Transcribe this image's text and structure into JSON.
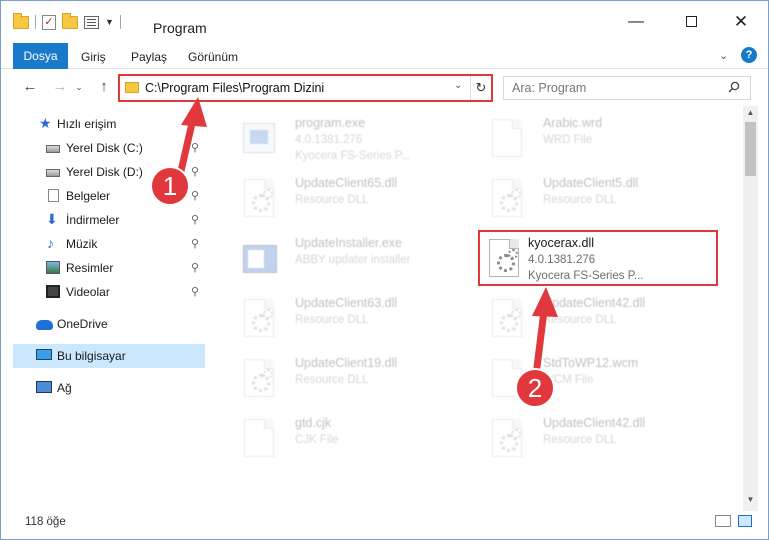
{
  "window": {
    "title": "Program",
    "minimize_glyph": "—",
    "close_glyph": "✕"
  },
  "ribbon": {
    "tabs": [
      "Dosya",
      "Giriş",
      "Paylaş",
      "Görünüm"
    ],
    "help_glyph": "?",
    "expand_glyph": "⌄"
  },
  "nav": {
    "back_glyph": "←",
    "forward_glyph": "→",
    "recent_glyph": "⌄",
    "up_glyph": "↑"
  },
  "address": {
    "path": "C:\\Program Files\\Program Dizini",
    "dropdown_glyph": "⌄",
    "refresh_glyph": "↻"
  },
  "search": {
    "placeholder": "Ara: Program"
  },
  "sidebar": {
    "items": [
      {
        "label": "Hızlı erişim",
        "icon": "star-icon"
      },
      {
        "label": "Yerel Disk (C:)",
        "icon": "disk-icon",
        "pinned": true
      },
      {
        "label": "Yerel Disk (D:)",
        "icon": "disk-icon",
        "pinned": true
      },
      {
        "label": "Belgeler",
        "icon": "documents-icon",
        "pinned": true
      },
      {
        "label": "İndirmeler",
        "icon": "download-icon",
        "pinned": true
      },
      {
        "label": "Müzik",
        "icon": "music-icon",
        "pinned": true
      },
      {
        "label": "Resimler",
        "icon": "pictures-icon",
        "pinned": true
      },
      {
        "label": "Videolar",
        "icon": "videos-icon",
        "pinned": true
      },
      {
        "label": "OneDrive",
        "icon": "onedrive-icon"
      },
      {
        "label": "Bu bilgisayar",
        "icon": "computer-icon",
        "selected": true
      },
      {
        "label": "Ağ",
        "icon": "network-icon"
      }
    ],
    "pin_glyph": "📌"
  },
  "files": [
    {
      "name": "program.exe",
      "line2": "4.0.1381.276",
      "line3": "Kyocera FS-Series P...",
      "icon": "exe-icon"
    },
    {
      "name": "Arabic.wrd",
      "line2": "WRD File",
      "line3": "",
      "icon": "page-icon"
    },
    {
      "name": "UpdateClient65.dll",
      "line2": "Resource DLL",
      "line3": "",
      "icon": "dll-icon"
    },
    {
      "name": "UpdateClient5.dll",
      "line2": "Resource DLL",
      "line3": "",
      "icon": "dll-icon"
    },
    {
      "name": "UpdateInstaller.exe",
      "line2": "ABBY updater installer",
      "line3": "",
      "icon": "installer-icon"
    },
    {
      "name": "kyocerax.dll",
      "line2": "4.0.1381.276",
      "line3": "Kyocera FS-Series P...",
      "icon": "dll-icon",
      "highlighted": true
    },
    {
      "name": "UpdateClient63.dll",
      "line2": "Resource DLL",
      "line3": "",
      "icon": "dll-icon"
    },
    {
      "name": "UpdateClient42.dll",
      "line2": "Resource DLL",
      "line3": "",
      "icon": "dll-icon"
    },
    {
      "name": "UpdateClient19.dll",
      "line2": "Resource DLL",
      "line3": "",
      "icon": "dll-icon"
    },
    {
      "name": "StdToWP12.wcm",
      "line2": "WCM File",
      "line3": "",
      "icon": "page-icon"
    },
    {
      "name": "gtd.cjk",
      "line2": "CJK File",
      "line3": "",
      "icon": "page-icon"
    },
    {
      "name": "UpdateClient42.dll",
      "line2": "Resource DLL",
      "line3": "",
      "icon": "dll-icon"
    }
  ],
  "status": {
    "item_count": "118 öğe"
  },
  "annotations": {
    "step1": "1",
    "step2": "2",
    "color": "#e0383c"
  }
}
